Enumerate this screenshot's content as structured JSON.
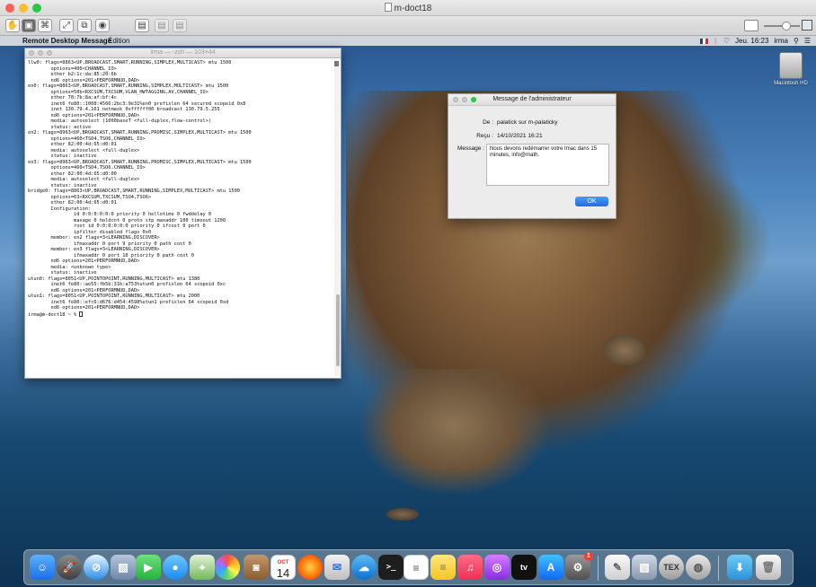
{
  "viewer": {
    "title": "m-doct18",
    "toolbar_icons": [
      "control-icon",
      "observe-icon",
      "binoculars-icon",
      "fit-screen-icon",
      "share-screen-icon",
      "screenshot-icon",
      "clipboard-get-icon",
      "clipboard-send-icon",
      "clipboard-icon"
    ]
  },
  "menubar": {
    "app_name": "Remote Desktop Message",
    "menu_items": [
      "Édition"
    ],
    "clock": "Jeu. 16:23",
    "user": "irma"
  },
  "desktop": {
    "drive_label": "Macintosh HD"
  },
  "terminal": {
    "title": "irma — -zsh — 103×44",
    "lines": [
      "llw0: flags=8863<UP,BROADCAST,SMART,RUNNING,SIMPLEX,MULTICAST> mtu 1500",
      "        options=400<CHANNEL_IO>",
      "        ether b2:1c:da:85:20:6b",
      "        nd6 options=201<PERFORMNUD,DAD>",
      "en0: flags=8863<UP,BROADCAST,SMART,RUNNING,SIMPLEX,MULTICAST> mtu 1500",
      "        options=50b<RXCSUM,TXCSUM,VLAN_HWTAGGING,AV,CHANNEL_IO>",
      "        ether 78:7b:8a:af:bf:4c",
      "        inet6 fe80::1008:4566:2bc3:9e31%en0 prefixlen 64 secured scopeid 0x8",
      "        inet 130.79.4.161 netmask 0xffffff00 broadcast 130.79.5.255",
      "        nd6 options=201<PERFORMNUD,DAD>",
      "        media: autoselect (1000baseT <full-duplex,flow-control>)",
      "        status: active",
      "en2: flags=8963<UP,BROADCAST,SMART,RUNNING,PROMISC,SIMPLEX,MULTICAST> mtu 1500",
      "        options=460<TSO4,TSO6,CHANNEL_IO>",
      "        ether 82:00:4d:65:d0:01",
      "        media: autoselect <full-duplex>",
      "        status: inactive",
      "en3: flags=8963<UP,BROADCAST,SMART,RUNNING,PROMISC,SIMPLEX,MULTICAST> mtu 1500",
      "        options=460<TSO4,TSO6,CHANNEL_IO>",
      "        ether 82:00:4d:65:d0:00",
      "        media: autoselect <full-duplex>",
      "        status: inactive",
      "bridge0: flags=8863<UP,BROADCAST,SMART,RUNNING,SIMPLEX,MULTICAST> mtu 1500",
      "        options=63<RXCSUM,TXCSUM,TSO4,TSO6>",
      "        ether 82:00:4d:65:d0:01",
      "        Configuration:",
      "                id 0:0:0:0:0:0 priority 0 hellotime 0 fwddelay 0",
      "                maxage 0 holdcnt 0 proto stp maxaddr 100 timeout 1200",
      "                root id 0:0:0:0:0:0 priority 0 ifcost 0 port 0",
      "                ipfilter disabled flags 0x0",
      "        member: en2 flags=3<LEARNING,DISCOVER>",
      "                ifmaxaddr 0 port 9 priority 0 path cost 0",
      "        member: en3 flags=3<LEARNING,DISCOVER>",
      "                ifmaxaddr 0 port 10 priority 0 path cost 0",
      "        nd6 options=201<PERFORMNUD,DAD>",
      "        media: <unknown type>",
      "        status: inactive",
      "utun0: flags=8051<UP,POINTOPOINT,RUNNING,MULTICAST> mtu 1380",
      "        inet6 fe80::ae55:fb5b:31b:a753%utun0 prefixlen 64 scopeid 0xc",
      "        nd6 options=201<PERFORMNUD,DAD>",
      "utun1: flags=8051<UP,POINTOPOINT,RUNNING,MULTICAST> mtu 2000",
      "        inet6 fe80::efc6:d676:d454:4598%utun1 prefixlen 64 scopeid 0xd",
      "        nd6 options=201<PERFORMNUD,DAD>"
    ],
    "prompt": "irma@m-doct18 ~ % "
  },
  "dialog": {
    "title": "Message de l'administrateur",
    "from_label": "De :",
    "from_value": "palatick sur m-palaticky",
    "received_label": "Reçu :",
    "received_value": "14/10/2021 16:21",
    "message_label": "Message :",
    "message_text": "Nous devons redémarrer votre Imac dans 15 minutes, info@math.",
    "ok_label": "OK"
  },
  "dock": {
    "calendar_month": "OCT",
    "calendar_day": "14",
    "appstore_badge": "1",
    "tv_label": "tv",
    "tex_label": "TEX"
  },
  "colors": {
    "close": "#ff5f57",
    "minimize": "#febc2e",
    "zoom": "#28c840",
    "accent": "#1c6fe0"
  }
}
